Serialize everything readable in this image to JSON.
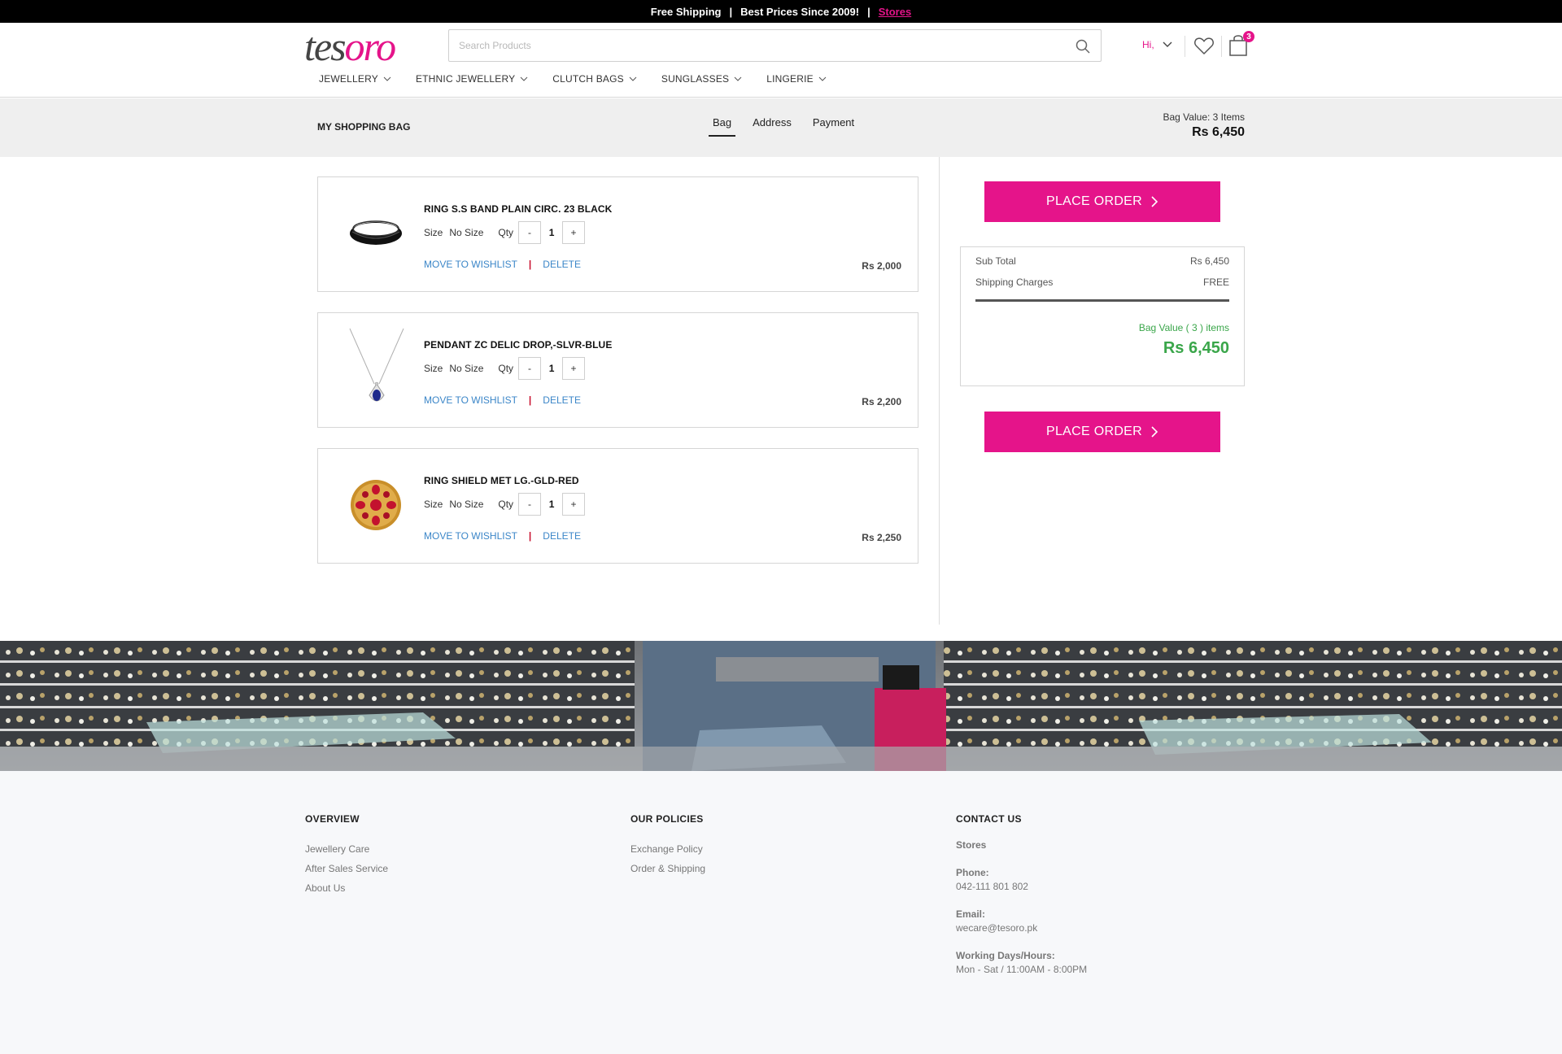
{
  "topbar": {
    "free_shipping": "Free Shipping",
    "separator": "|",
    "best_prices": "Best Prices Since 2009!",
    "stores_link": "Stores"
  },
  "header": {
    "logo_part1": "tes",
    "logo_part2": "oro",
    "search_placeholder": "Search Products",
    "account_label": "Hi,",
    "cart_count": "3"
  },
  "nav": {
    "items": [
      "JEWELLERY",
      "ETHNIC JEWELLERY",
      "CLUTCH BAGS",
      "SUNGLASSES",
      "LINGERIE"
    ]
  },
  "bag_header": {
    "title": "MY SHOPPING BAG",
    "steps": [
      "Bag",
      "Address",
      "Payment"
    ],
    "active_step": "Bag",
    "bag_value_label": "Bag Value: 3 Items",
    "bag_value_amount": "Rs 6,450"
  },
  "cart_items": [
    {
      "name": "RING S.S BAND PLAIN CIRC. 23 BLACK",
      "size_label": "Size",
      "size_value": "No Size",
      "qty_label": "Qty",
      "qty": "1",
      "minus": "-",
      "plus": "+",
      "wishlist_label": "MOVE TO WISHLIST",
      "separator": "|",
      "delete_label": "DELETE",
      "price": "Rs 2,000"
    },
    {
      "name": "PENDANT ZC DELIC DROP,-SLVR-BLUE",
      "size_label": "Size",
      "size_value": "No Size",
      "qty_label": "Qty",
      "qty": "1",
      "minus": "-",
      "plus": "+",
      "wishlist_label": "MOVE TO WISHLIST",
      "separator": "|",
      "delete_label": "DELETE",
      "price": "Rs 2,200"
    },
    {
      "name": "RING SHIELD MET LG.-GLD-RED",
      "size_label": "Size",
      "size_value": "No Size",
      "qty_label": "Qty",
      "qty": "1",
      "minus": "-",
      "plus": "+",
      "wishlist_label": "MOVE TO WISHLIST",
      "separator": "|",
      "delete_label": "DELETE",
      "price": "Rs 2,250"
    }
  ],
  "summary": {
    "place_order_label": "PLACE ORDER",
    "subtotal_label": "Sub Total",
    "subtotal_value": "Rs 6,450",
    "shipping_label": "Shipping Charges",
    "shipping_value": "FREE",
    "bag_value_label": "Bag Value ( 3 ) items",
    "bag_value_amount": "Rs 6,450"
  },
  "footer": {
    "overview": {
      "heading": "OVERVIEW",
      "links": [
        "Jewellery Care",
        "After Sales Service",
        "About Us"
      ]
    },
    "policies": {
      "heading": "OUR POLICIES",
      "links": [
        "Exchange Policy",
        "Order & Shipping"
      ]
    },
    "contact": {
      "heading": "CONTACT US",
      "stores": "Stores",
      "phone_label": "Phone:",
      "phone": "042-111 801 802",
      "email_label": "Email:",
      "email": "wecare@tesoro.pk",
      "hours_label": "Working Days/Hours:",
      "hours": "Mon - Sat / 11:00AM - 8:00PM"
    }
  },
  "colors": {
    "brand_pink": "#e5148a",
    "success_green": "#3aa64a",
    "link_blue": "#3b86c8",
    "topbar_bg": "#000000"
  },
  "icons": {
    "search": "search-icon",
    "chevron": "chevron-down-icon",
    "wishlist": "heart-icon",
    "cart": "shopping-bag-icon",
    "place_order_arrow": "chevron-right-icon"
  }
}
